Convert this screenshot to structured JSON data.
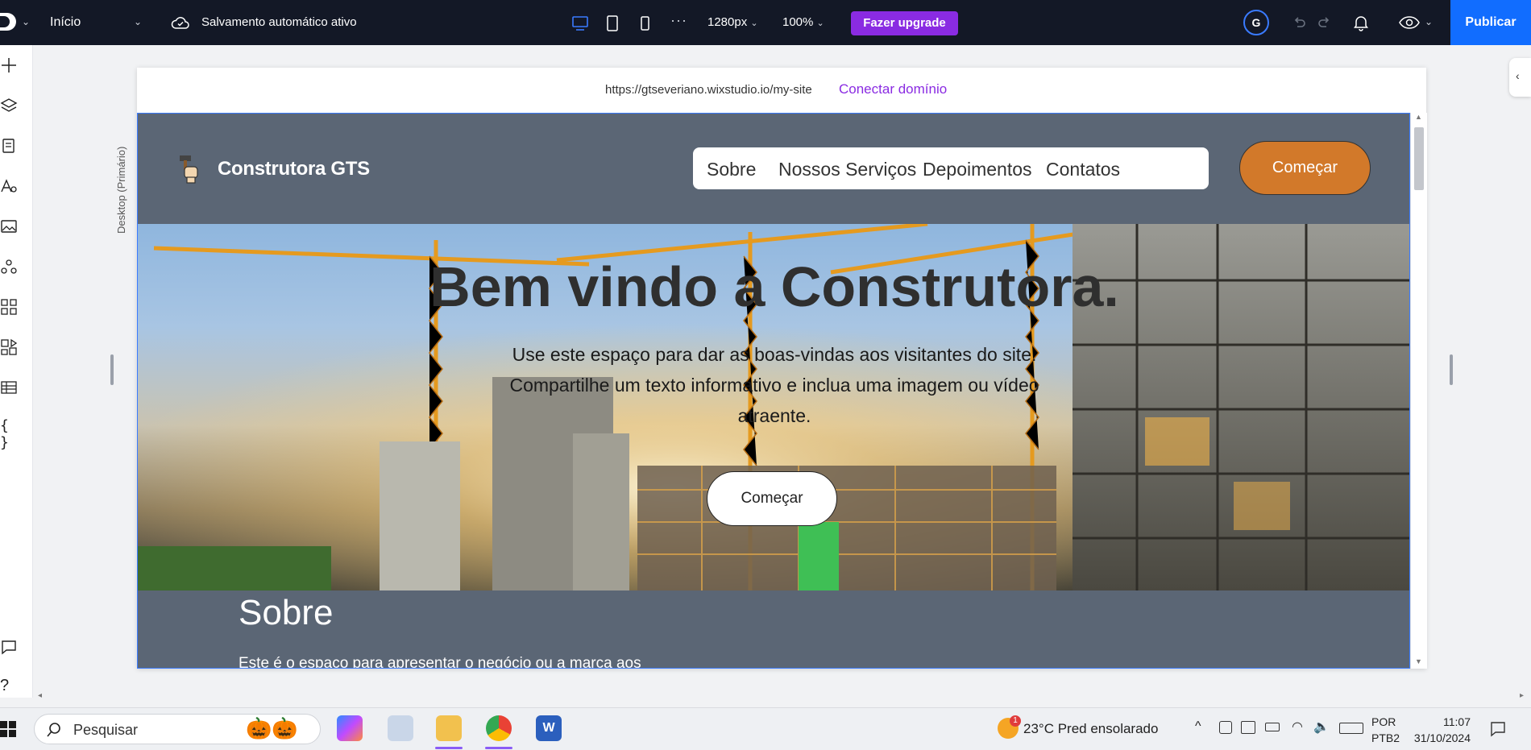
{
  "topbar": {
    "page_label": "Início",
    "autosave_label": "Salvamento automático ativo",
    "width_label": "1280px",
    "zoom_label": "100%",
    "upgrade_label": "Fazer upgrade",
    "avatar_letter": "G",
    "publish_label": "Publicar",
    "accent": "#116dff",
    "upgrade_color": "#8a2be2"
  },
  "left_tools": [
    "add-icon",
    "layers-icon",
    "pages-icon",
    "theme-icon",
    "media-icon",
    "apps-icon",
    "grid-icon",
    "business-icon",
    "table-icon",
    "code-icon",
    "comments-icon",
    "help-icon"
  ],
  "canvas": {
    "viewport_label": "Desktop (Primário)",
    "url": "https://gtseveriano.wixstudio.io/my-site",
    "connect_domain": "Conectar domínio"
  },
  "site": {
    "brand": "Construtora GTS",
    "nav": [
      "Sobre",
      "Nossos Serviços",
      "Depoimentos",
      "Contatos"
    ],
    "header_cta": "Começar",
    "header_cta_color": "#d2792a",
    "hero_title": "Bem vindo a Construtora.",
    "hero_text": "Use este espaço para dar as boas-vindas aos visitantes do site. Compartilhe um texto informativo e inclua uma imagem ou vídeo atraente.",
    "hero_cta": "Começar",
    "about_title": "Sobre",
    "about_text": "Este é o espaço para apresentar o negócio ou a marca aos",
    "section_bg": "#5b6675"
  },
  "taskbar": {
    "search_placeholder": "Pesquisar",
    "weather": "23°C  Pred ensolarado",
    "weather_badge": "1",
    "lang_top": "POR",
    "lang_bottom": "PTB2",
    "time": "11:07",
    "date": "31/10/2024"
  }
}
